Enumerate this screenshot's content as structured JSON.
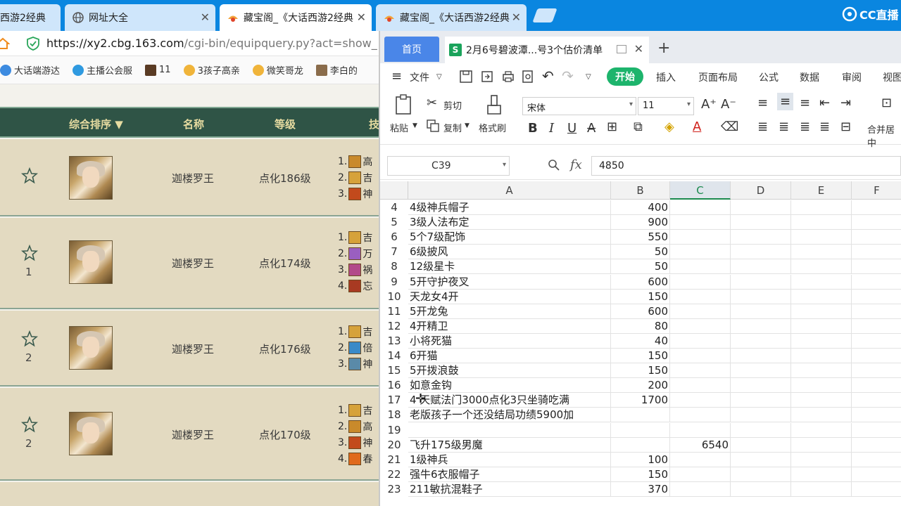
{
  "browser": {
    "tabs": [
      {
        "label": "西游2经典",
        "active": false
      },
      {
        "label": "网址大全",
        "active": false
      },
      {
        "label": "藏宝阁_《大话西游2经典",
        "active": true
      },
      {
        "label": "藏宝阁_《大话西游2经典",
        "active": false
      }
    ],
    "brand": "CC直播",
    "url_main": "https://xy2.cbg.163.com",
    "url_rest": "/cgi-bin/equipquery.py?act=show_",
    "bookmarks": [
      "大话端游达",
      "主播公会服",
      "11",
      "3孩子高亲",
      "微笑哥龙",
      "李白的"
    ],
    "table_headers": {
      "sort": "综合排序 ▼",
      "name": "名称",
      "level": "等级",
      "skills": "技"
    },
    "listings": [
      {
        "star_count": "",
        "name": "迦楼罗王",
        "level": "点化186级",
        "skills": [
          {
            "n": "1.",
            "t": "高"
          },
          {
            "n": "2.",
            "t": "吉"
          },
          {
            "n": "3.",
            "t": "神"
          }
        ]
      },
      {
        "star_count": "1",
        "name": "迦楼罗王",
        "level": "点化174级",
        "skills": [
          {
            "n": "1.",
            "t": "吉"
          },
          {
            "n": "2.",
            "t": "万"
          },
          {
            "n": "3.",
            "t": "祸"
          },
          {
            "n": "4.",
            "t": "忘"
          }
        ]
      },
      {
        "star_count": "2",
        "name": "迦楼罗王",
        "level": "点化176级",
        "skills": [
          {
            "n": "1.",
            "t": "吉"
          },
          {
            "n": "2.",
            "t": "倍"
          },
          {
            "n": "3.",
            "t": "神"
          }
        ]
      },
      {
        "star_count": "2",
        "name": "迦楼罗王",
        "level": "点化170级",
        "skills": [
          {
            "n": "1.",
            "t": "吉"
          },
          {
            "n": "2.",
            "t": "高"
          },
          {
            "n": "3.",
            "t": "神"
          },
          {
            "n": "4.",
            "t": "春"
          }
        ]
      }
    ]
  },
  "wps": {
    "home_tab": "首页",
    "doc_title": "2月6号碧波潭...号3个估价清单",
    "doc_icon": "S",
    "menu": {
      "file": "文件",
      "start": "开始",
      "insert": "插入",
      "layout": "页面布局",
      "formula": "公式",
      "data": "数据",
      "review": "审阅",
      "view": "视图"
    },
    "ribbon": {
      "paste": "粘贴",
      "cut": "剪切",
      "copy": "复制",
      "format_painter": "格式刷",
      "font": "宋体",
      "size": "11",
      "merge": "合并居中"
    },
    "cell_ref": "C39",
    "formula_value": "4850",
    "columns": [
      "A",
      "B",
      "C",
      "D",
      "E",
      "F"
    ],
    "selected_column": "C",
    "rows": [
      {
        "r": "4",
        "a": "4级神兵帽子",
        "b": "400",
        "c": ""
      },
      {
        "r": "5",
        "a": "3级人法布定",
        "b": "900",
        "c": ""
      },
      {
        "r": "6",
        "a": "5个7级配饰",
        "b": "550",
        "c": ""
      },
      {
        "r": "7",
        "a": "6级披风",
        "b": "50",
        "c": ""
      },
      {
        "r": "8",
        "a": "12级星卡",
        "b": "50",
        "c": ""
      },
      {
        "r": "9",
        "a": "5开守护夜叉",
        "b": "600",
        "c": ""
      },
      {
        "r": "10",
        "a": "天龙女4开",
        "b": "150",
        "c": ""
      },
      {
        "r": "11",
        "a": "5开龙兔",
        "b": "600",
        "c": ""
      },
      {
        "r": "12",
        "a": "4开精卫",
        "b": "80",
        "c": ""
      },
      {
        "r": "13",
        "a": "小将死猫",
        "b": "40",
        "c": ""
      },
      {
        "r": "14",
        "a": "6开猫",
        "b": "150",
        "c": ""
      },
      {
        "r": "15",
        "a": "5开拨浪鼓",
        "b": "150",
        "c": ""
      },
      {
        "r": "16",
        "a": "如意金钩",
        "b": "200",
        "c": ""
      },
      {
        "r": "17",
        "a": "4 天赋法门3000点化3只坐骑吃满",
        "b": "1700",
        "c": ""
      },
      {
        "r": "18",
        "a": "老版孩子一个还没结局功绩5900加",
        "b": "",
        "c": ""
      },
      {
        "r": "19",
        "a": "",
        "b": "",
        "c": ""
      },
      {
        "r": "20",
        "a": "飞升175级男魔",
        "b": "",
        "c": "6540"
      },
      {
        "r": "21",
        "a": "1级神兵",
        "b": "100",
        "c": ""
      },
      {
        "r": "22",
        "a": "强牛6衣服帽子",
        "b": "150",
        "c": ""
      },
      {
        "r": "23",
        "a": "211敏抗混鞋子",
        "b": "370",
        "c": ""
      }
    ]
  }
}
